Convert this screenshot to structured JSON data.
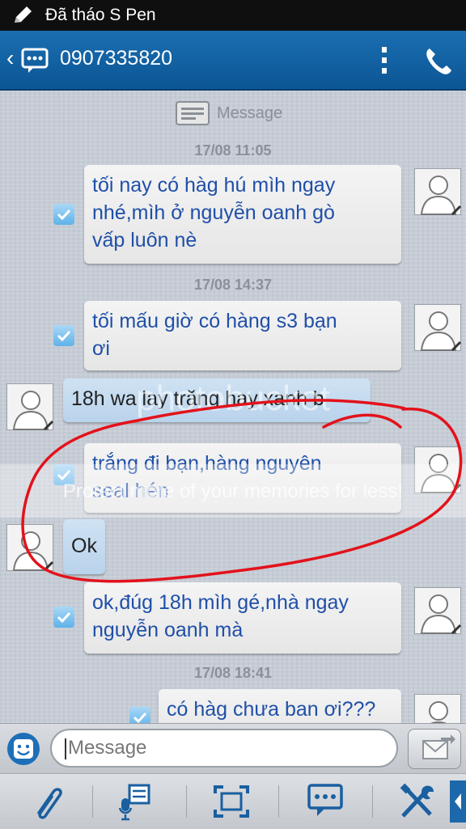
{
  "status_bar": {
    "notification": "Đã tháo S Pen"
  },
  "title_bar": {
    "back_glyph": "‹",
    "contact_number": "0907335820"
  },
  "thread": {
    "header_label": "Message",
    "messages": [
      {
        "timestamp": "17/08 11:05",
        "direction": "out",
        "lines": [
          "tối nay có hàg hú mìh ngay",
          "nhé,mìh ở nguyễn oanh gò",
          "vấp luôn nè"
        ]
      },
      {
        "timestamp": "17/08 14:37",
        "direction": "out",
        "lines": [
          "tối mấu giờ  có hàng s3 bạn",
          "ơi"
        ]
      },
      {
        "direction": "in",
        "lines": [
          "18h wa lay trăng hay xanh b"
        ]
      },
      {
        "direction": "out",
        "lines": [
          "trắng đi bạn,hàng nguyên",
          "seal hén"
        ]
      },
      {
        "direction": "in",
        "lines": [
          "Ok"
        ]
      },
      {
        "direction": "out",
        "lines": [
          "ok,đúg 18h mìh gé,nhà ngay",
          "nguyễn oanh mà"
        ]
      },
      {
        "timestamp": "17/08 18:41",
        "direction": "out",
        "lines": [
          "có hàg chưa ban ơi???"
        ]
      }
    ],
    "watermark": {
      "brand": "photobucket",
      "tagline": "Protect more of your memories for less!"
    }
  },
  "composer": {
    "placeholder": "Message"
  },
  "icons": {
    "status": "pen-icon",
    "title": [
      "messages-app-icon",
      "overflow-menu-icon",
      "phone-call-icon"
    ],
    "composer": [
      "emoticon-icon",
      "send-icon"
    ],
    "toolbar": [
      "attach-icon",
      "voice-input-icon",
      "screen-capture-icon",
      "chat-icon",
      "tools-icon",
      "expand-arrow-icon"
    ]
  },
  "colors": {
    "title_bar": "#0c5594",
    "outgoing_text": "#1f4fa8",
    "incoming_bubble": "#c6dbef",
    "annotation": "#e3121b"
  }
}
